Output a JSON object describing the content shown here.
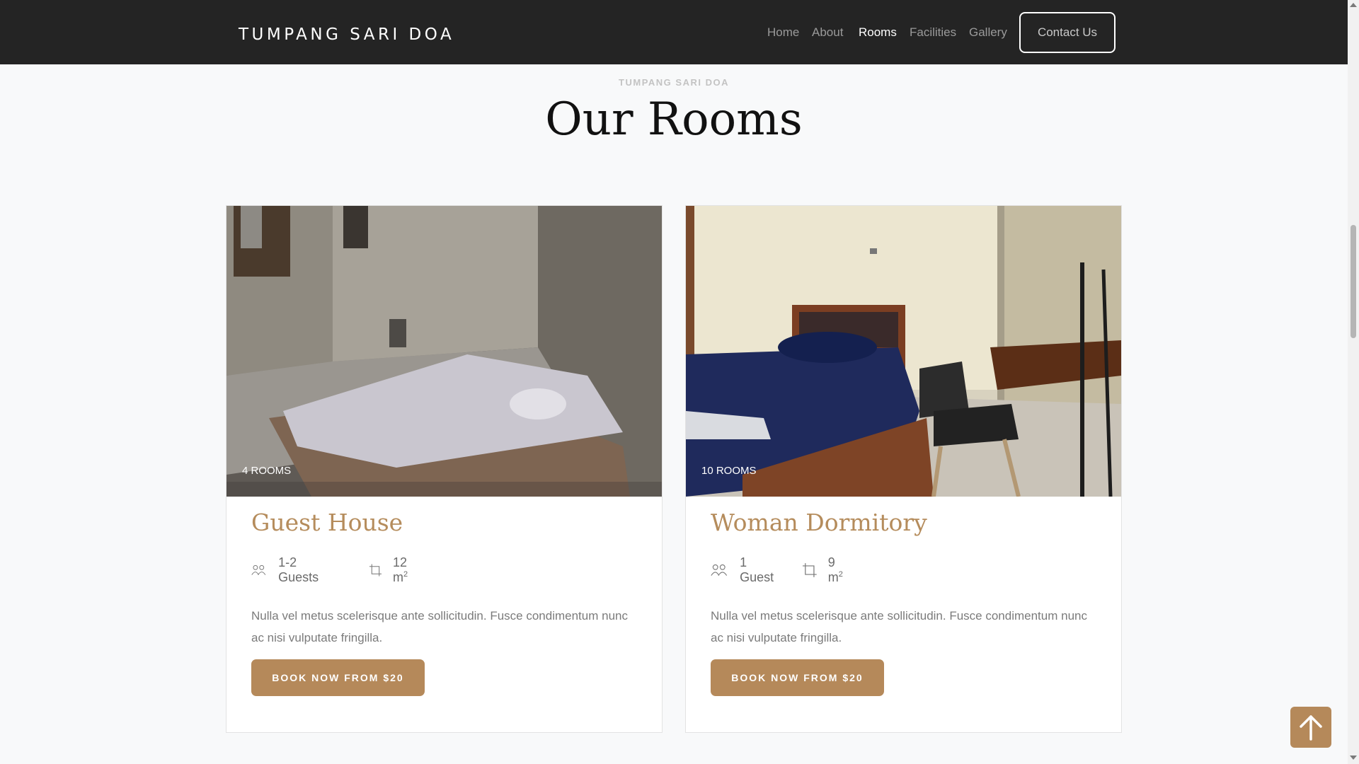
{
  "navbar": {
    "brand": "TUMPANG SARI DOA",
    "links": [
      {
        "label": "Home"
      },
      {
        "label": "About"
      },
      {
        "label": "Rooms"
      },
      {
        "label": "Facilities"
      },
      {
        "label": "Gallery"
      }
    ],
    "active_link": "Rooms",
    "contact_label": "Contact Us"
  },
  "section": {
    "eyebrow": "TUMPANG SARI DOA",
    "title": "Our Rooms"
  },
  "rooms": [
    {
      "count_label": "4 ROOMS",
      "title": "Guest House",
      "guests": "1-2 Guests",
      "size": "12 m",
      "size_sup": "2",
      "description": "Nulla vel metus scelerisque ante sollicitudin. Fusce condimentum nunc ac nisi vulputate fringilla.",
      "book_label": "BOOK NOW FROM $20"
    },
    {
      "count_label": "10 ROOMS",
      "title": "Woman Dormitory",
      "guests": "1 Guest",
      "size": "9 m",
      "size_sup": "2",
      "description": "Nulla vel metus scelerisque ante sollicitudin. Fusce condimentum nunc ac nisi vulputate fringilla.",
      "book_label": "BOOK NOW FROM $20"
    }
  ],
  "icons": {
    "guests": "users-icon",
    "size": "crop-icon",
    "back_to_top": "arrow-up-icon"
  },
  "colors": {
    "navbar_bg": "#242424",
    "accent": "#b5895a",
    "title_accent": "#b58c5c",
    "page_bg": "#f8f9fa"
  }
}
